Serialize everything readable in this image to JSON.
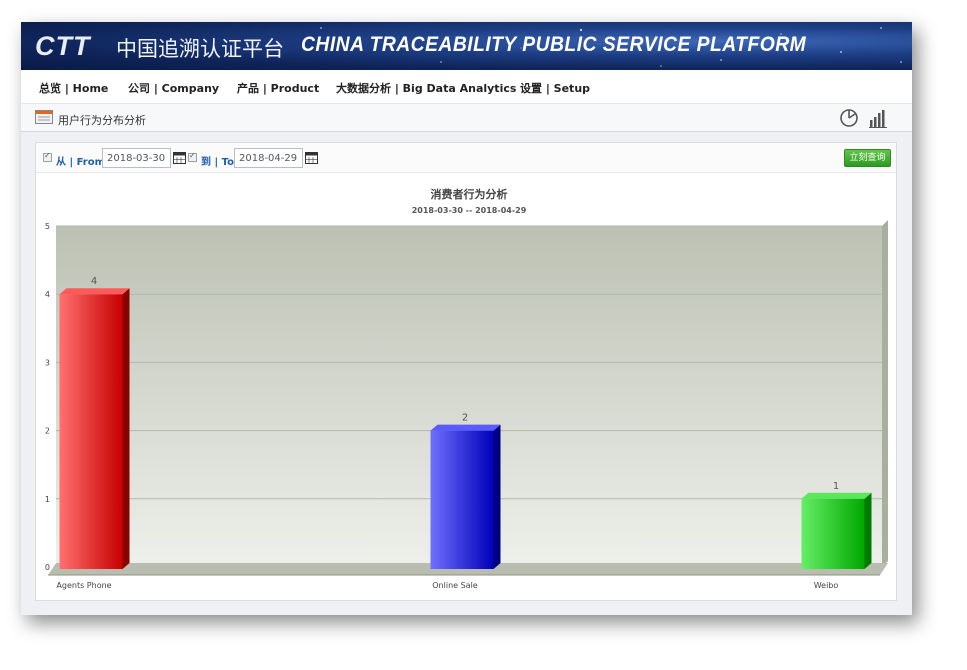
{
  "header": {
    "logo_text": "CTT",
    "title_cn": "中国追溯认证平台",
    "title_en": "CHINA TRACEABILITY PUBLIC SERVICE PLATFORM"
  },
  "nav": {
    "items": [
      {
        "label": "总览 | Home"
      },
      {
        "label": "公司 | Company"
      },
      {
        "label": "产品 | Product"
      },
      {
        "label": "大数据分析 | Big Data Analytics"
      },
      {
        "label": "设置 | Setup"
      }
    ]
  },
  "subheader": {
    "title": "用户行为分布分析",
    "icons": [
      "pie-chart-icon",
      "bar-chart-icon"
    ]
  },
  "filter": {
    "from_label": "从 | From:",
    "from_value": "2018-03-30",
    "to_label": "到 | To:",
    "to_value": "2018-04-29",
    "query_button": "立刻查询"
  },
  "colors": {
    "bar_red": "#e02020",
    "bar_blue": "#2222dd",
    "bar_green": "#22cc22",
    "query_green": "#3aa82a",
    "banner_blue": "#1e3f86"
  },
  "chart_data": {
    "type": "bar",
    "title": "消费者行为分析",
    "subtitle": "2018-03-30 -- 2018-04-29",
    "categories": [
      "Agents Phone",
      "Online Sale",
      "Weibo"
    ],
    "values": [
      4,
      2,
      1
    ],
    "bar_colors": [
      "red",
      "blue",
      "green"
    ],
    "ylim": [
      0,
      5
    ],
    "yticks": [
      0,
      1,
      2,
      3,
      4,
      5
    ],
    "xlabel": "",
    "ylabel": "",
    "grid": true,
    "data_labels": true,
    "style": "3d"
  }
}
